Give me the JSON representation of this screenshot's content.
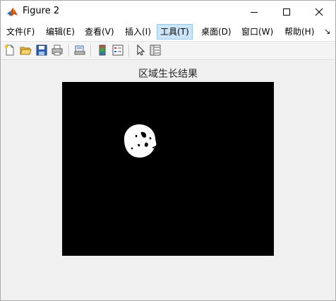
{
  "window": {
    "title": "Figure 2"
  },
  "menu": {
    "items": [
      {
        "label": "文件(F)"
      },
      {
        "label": "编辑(E)"
      },
      {
        "label": "查看(V)"
      },
      {
        "label": "插入(I)"
      },
      {
        "label": "工具(T)"
      },
      {
        "label": "桌面(D)"
      },
      {
        "label": "窗口(W)"
      },
      {
        "label": "帮助(H)"
      }
    ],
    "active_index": 4,
    "overflow_glyph": "↘"
  },
  "toolbar": {
    "buttons": [
      "new-figure-icon",
      "open-file-icon",
      "save-icon",
      "print-icon",
      "print-preview-icon",
      "colorbar-icon",
      "legend-icon",
      "edit-plot-icon",
      "property-inspector-icon"
    ]
  },
  "figure": {
    "title": "区域生长结果",
    "image_background": "#000000",
    "region_color": "#ffffff"
  }
}
